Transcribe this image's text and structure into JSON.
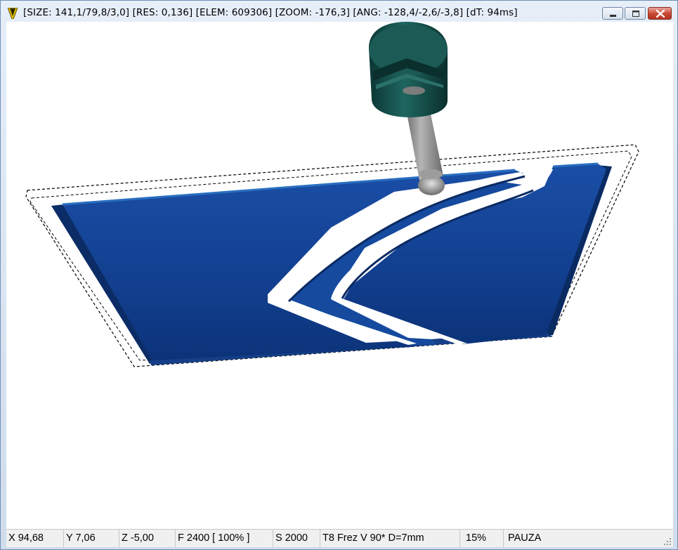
{
  "window": {
    "title": "[SIZE: 141,1/79,8/3,0] [RES: 0,136] [ELEM: 609306] [ZOOM: -176,3] [ANG: -128,4/-2,6/-3,8] [dT: 94ms]"
  },
  "status": {
    "x": "X 94,68",
    "y": "Y 7,06",
    "z": "Z -5,00",
    "feed": "F 2400 [ 100% ]",
    "spindle": "S 2000",
    "tool": "T8 Frez V 90* D=7mm",
    "progress": "15%",
    "state": "PAUZA"
  },
  "colors": {
    "workpiece": "#0f4496",
    "tool_body": "#0f4a45",
    "tool_shank": "#8f8f8f"
  }
}
